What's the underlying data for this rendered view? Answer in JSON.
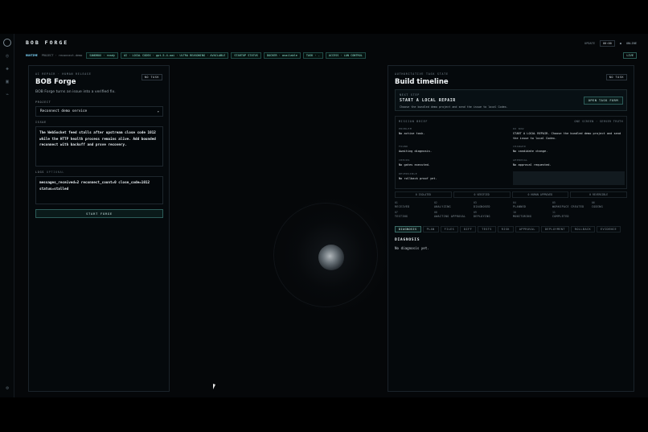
{
  "app": {
    "brand": "BOB FORGE",
    "update_label": "UPDATE",
    "clock": "00:00",
    "connection": "ONLINE"
  },
  "status_strip": {
    "label": "RUNTIME",
    "project": "PROJECT · reconnect-demo",
    "pills": [
      "SANDBOX · ready",
      "AI · LOCAL CODEX · gpt-5.4-oai · ULTRA REASONING · AVAILABLE",
      "STARTUP STATUS",
      "DOCKER · available",
      "TASK · -",
      "ACCESS · LAN CONTROL"
    ],
    "live_label": "LIVE"
  },
  "left_panel": {
    "eyebrow": "AI REPAIR · HUMAN RELEASE",
    "title": "BOB Forge",
    "chip": "NO TASK",
    "tagline": "BOB Forge turns an issue into a verified fix.",
    "project_label": "PROJECT",
    "project_value": "Reconnect demo service",
    "issue_label": "ISSUE",
    "issue_value": "The WebSocket feed stalls after upstream close code 1012 while the HTTP health process remains alive. Add bounded reconnect with backoff and prove recovery.",
    "logs_label": "LOGS",
    "logs_optional": "OPTIONAL",
    "logs_value": "messages_received=2 reconnect_count=0 close_code=1012 status=stalled",
    "start_button": "START FORGE"
  },
  "right_panel": {
    "eyebrow": "AUTHORITATIVE TASK STATE",
    "title": "Build timeline",
    "chip": "NO TASK",
    "next_step": {
      "eyebrow": "NEXT STEP",
      "title": "START A LOCAL REPAIR",
      "description": "Choose the bundled demo project and send the issue to local Codex.",
      "button": "OPEN TASK FORM"
    },
    "brief": {
      "heading": "MISSION BRIEF",
      "readiness": "ONE SCREEN · SERVER TRUTH",
      "cells": [
        {
          "key": "PROBLEM",
          "value": "No active task."
        },
        {
          "key": "DO NOW",
          "value": "START A LOCAL REPAIR. Choose the bundled demo project and send the issue to local Codex."
        },
        {
          "key": "FOUND",
          "value": "Awaiting diagnosis."
        },
        {
          "key": "CHANGED",
          "value": "No candidate change."
        },
        {
          "key": "CHECKS",
          "value": "No gates executed."
        },
        {
          "key": "APPROVAL",
          "value": "No approval requested."
        },
        {
          "key": "REVERSIBLE",
          "value": "No rollback proof yet."
        }
      ]
    },
    "stats": [
      "0 ISOLATED",
      "0 VERIFIED",
      "0 HUMAN APPROVED",
      "0 REVERSIBLE"
    ],
    "lanes": [
      {
        "num": "01",
        "name": "RECEIVED"
      },
      {
        "num": "02",
        "name": "ANALYZING"
      },
      {
        "num": "03",
        "name": "DIAGNOSED"
      },
      {
        "num": "04",
        "name": "PLANNED"
      },
      {
        "num": "05",
        "name": "WORKSPACE CREATED"
      },
      {
        "num": "06",
        "name": "CODING"
      },
      {
        "num": "07",
        "name": "TESTING"
      },
      {
        "num": "08",
        "name": "AWAITING APPROVAL"
      },
      {
        "num": "09",
        "name": "DEPLOYING"
      },
      {
        "num": "10",
        "name": "MONITORING"
      },
      {
        "num": "11",
        "name": "COMPLETED"
      }
    ],
    "tabs": [
      "DIAGNOSIS",
      "PLAN",
      "FILES",
      "DIFF",
      "TESTS",
      "RISK",
      "APPROVAL",
      "DEPLOYMENT",
      "ROLLBACK",
      "EVIDENCE"
    ],
    "active_tab": "DIAGNOSIS",
    "diagnosis_heading": "DIAGNOSIS",
    "diagnosis_text": "No diagnosis yet."
  }
}
